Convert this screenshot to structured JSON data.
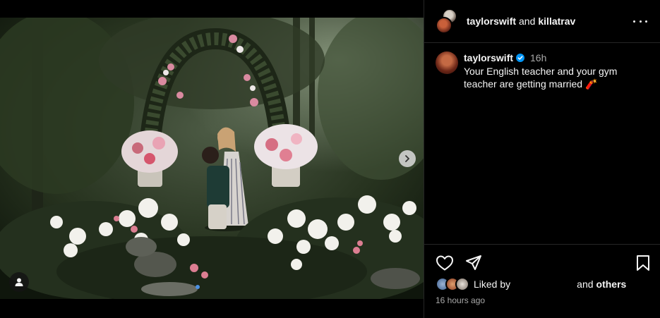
{
  "post": {
    "image_alt": "Couple embracing in a flower garden under a floral arch",
    "carousel": {
      "active_index": 0,
      "count": 2
    }
  },
  "header": {
    "user1": "taylorswift",
    "joiner": "and",
    "user2": "killatrav",
    "more_icon": "more-horizontal-icon"
  },
  "caption": {
    "username": "taylorswift",
    "verified": true,
    "age": "16h",
    "text": "Your English teacher and your gym teacher are getting married 🧨"
  },
  "actions": {
    "icons": [
      "heart-icon",
      "share-icon",
      "bookmark-icon"
    ]
  },
  "likes": {
    "prefix": "Liked by",
    "suffix": "and",
    "others": "others"
  },
  "timestamp": "16 hours ago",
  "colors": {
    "background": "#000000",
    "border": "#262626",
    "muted_text": "#a8a8a8",
    "verified_blue": "#0095f6"
  }
}
